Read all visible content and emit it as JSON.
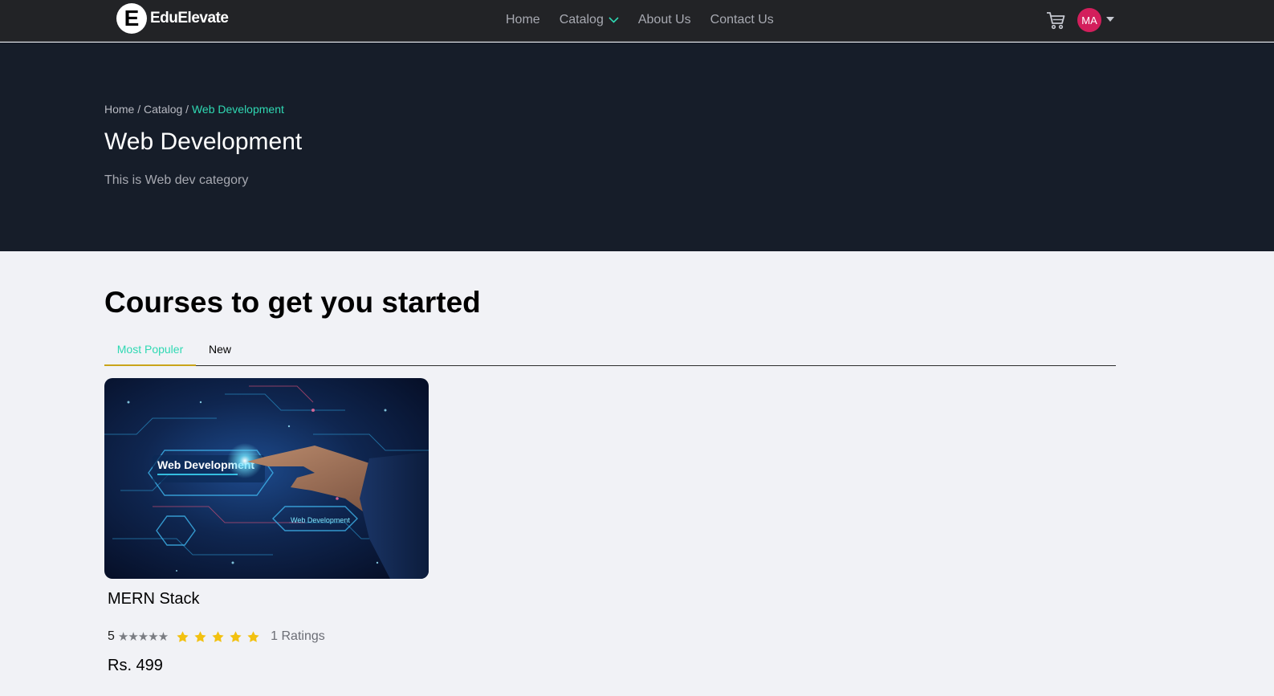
{
  "brand": {
    "logo_letter": "E",
    "name": "EduElevate"
  },
  "nav": {
    "home": "Home",
    "catalog": "Catalog",
    "about": "About Us",
    "contact": "Contact Us",
    "cart_icon": "cart-icon",
    "avatar_initials": "MA",
    "avatar_color": "#d31f5c"
  },
  "hero": {
    "breadcrumb": {
      "home": "Home",
      "sep": " / ",
      "catalog": "Catalog",
      "current": "Web Development"
    },
    "title": "Web Development",
    "description": "This is Web dev category"
  },
  "section": {
    "title": "Courses to get you started",
    "tabs": [
      "Most Populer",
      "New"
    ],
    "active_tab": "Most Populer"
  },
  "courses": [
    {
      "name": "MERN Stack",
      "thumbnail_text": "Web Development",
      "thumbnail_subtext": "Web Development",
      "rating": "5",
      "rating_value": 5,
      "ratings_count": "1 Ratings",
      "price": "Rs. 499"
    }
  ],
  "colors": {
    "navbar_bg": "#222326",
    "hero_bg": "#161d29",
    "accent_teal": "#2fd9b3",
    "star_gold": "#f2c110",
    "tab_underline": "#c9a41a"
  }
}
